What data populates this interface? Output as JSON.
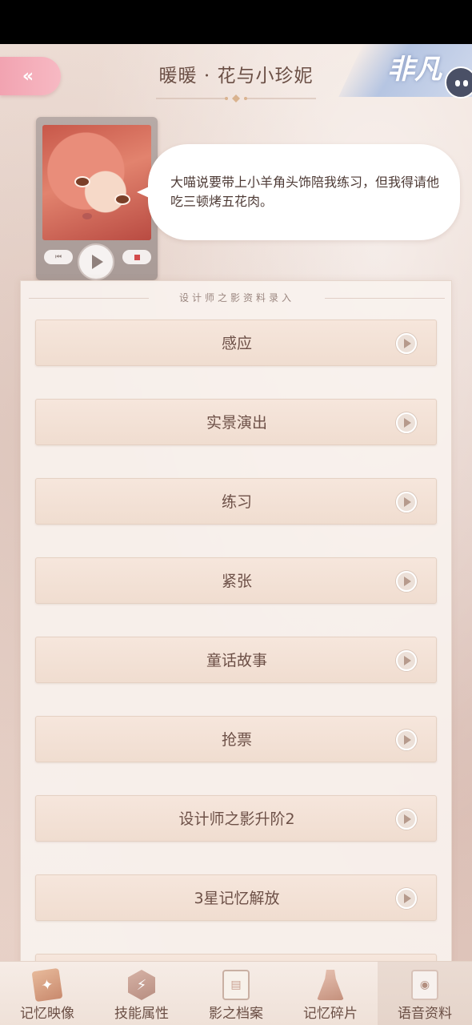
{
  "header": {
    "title": "暖暖 · 花与小珍妮",
    "rarity": "非凡",
    "back_icon": "«"
  },
  "player": {
    "prev_icon": "⏮",
    "quote": "大喵说要带上小羊角头饰陪我练习，但我得请他吃三顿烤五花肉。"
  },
  "records": {
    "section_title": "设计师之影资料录入",
    "items": [
      {
        "label": "感应"
      },
      {
        "label": "实景演出"
      },
      {
        "label": "练习"
      },
      {
        "label": "紧张"
      },
      {
        "label": "童话故事"
      },
      {
        "label": "抢票"
      },
      {
        "label": "设计师之影升阶2"
      },
      {
        "label": "3星记忆解放"
      }
    ]
  },
  "bottom_nav": {
    "items": [
      {
        "label": "记忆映像",
        "icon": "memory-image-icon",
        "glyph": "✦"
      },
      {
        "label": "技能属性",
        "icon": "skill-icon",
        "glyph": "⚡"
      },
      {
        "label": "影之档案",
        "icon": "archive-icon",
        "glyph": "▤"
      },
      {
        "label": "记忆碎片",
        "icon": "fragment-icon",
        "glyph": ""
      },
      {
        "label": "语音资料",
        "icon": "voice-icon",
        "glyph": "◉"
      }
    ],
    "active": "语音资料"
  },
  "colors": {
    "accent_pink": "#f2a3b1",
    "text_brown": "#6d5047",
    "button_bg": "#f6e6dc"
  }
}
